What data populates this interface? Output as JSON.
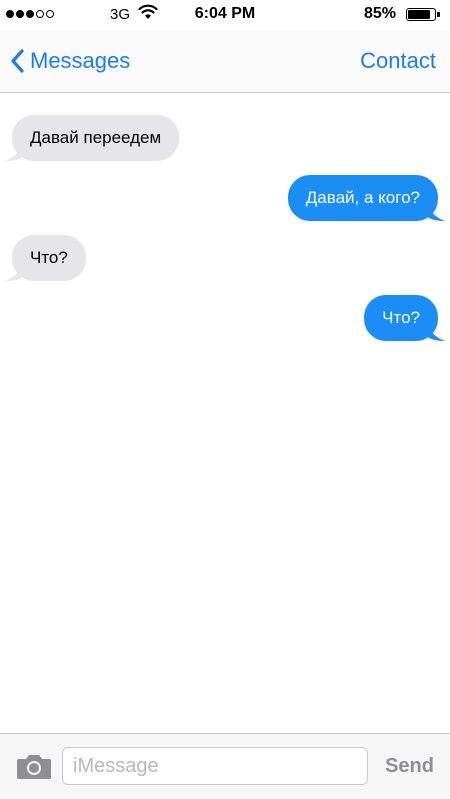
{
  "status_bar": {
    "carrier": "3G",
    "time": "6:04 PM",
    "battery_percent": "85%",
    "battery_level": 0.85,
    "signal_bars_filled": 3,
    "signal_bars_total": 5
  },
  "nav": {
    "back_label": "Messages",
    "contact_label": "Contact"
  },
  "messages": [
    {
      "direction": "incoming",
      "text": "Давай переедем"
    },
    {
      "direction": "outgoing",
      "text": "Давай, а кого?"
    },
    {
      "direction": "incoming",
      "text": "Что?"
    },
    {
      "direction": "outgoing",
      "text": "Что?"
    }
  ],
  "input_bar": {
    "placeholder": "iMessage",
    "value": "",
    "send_label": "Send"
  },
  "colors": {
    "accent": "#1a7cf4",
    "outgoing_bubble": "#1b8ef6",
    "incoming_bubble": "#e5e5ea",
    "send_disabled": "#8e8e93"
  },
  "icons": {
    "back": "chevron-left-icon",
    "camera": "camera-icon",
    "wifi": "wifi-icon",
    "battery": "battery-icon"
  }
}
